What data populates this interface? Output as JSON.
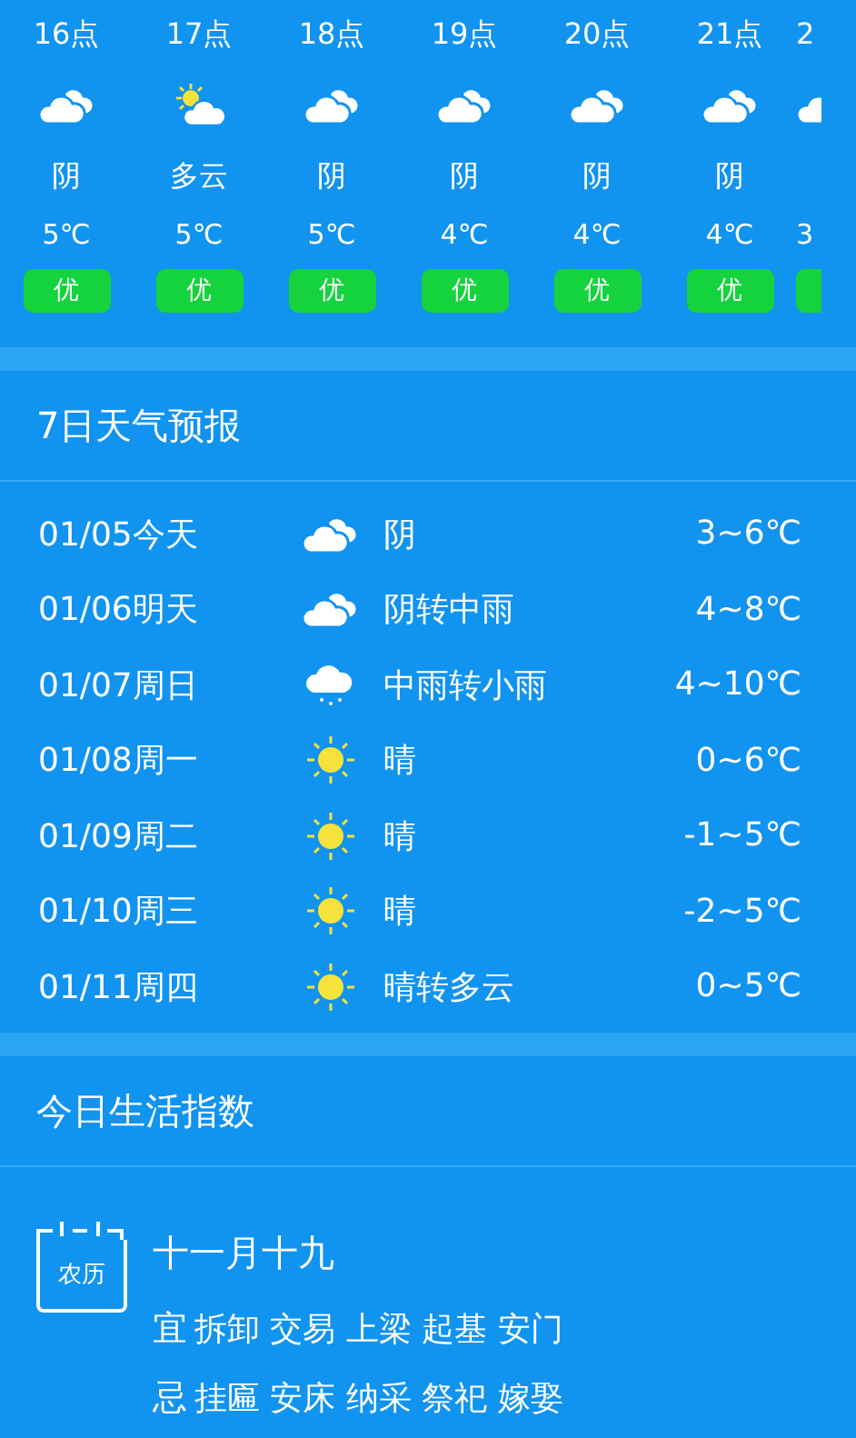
{
  "hourly": [
    {
      "hour": "16点",
      "kind": "cloudy",
      "condition": "阴",
      "temp": "5℃",
      "aqi": "优"
    },
    {
      "hour": "17点",
      "kind": "partly_cloudy",
      "condition": "多云",
      "temp": "5℃",
      "aqi": "优"
    },
    {
      "hour": "18点",
      "kind": "cloudy",
      "condition": "阴",
      "temp": "5℃",
      "aqi": "优"
    },
    {
      "hour": "19点",
      "kind": "cloudy",
      "condition": "阴",
      "temp": "4℃",
      "aqi": "优"
    },
    {
      "hour": "20点",
      "kind": "cloudy",
      "condition": "阴",
      "temp": "4℃",
      "aqi": "优"
    },
    {
      "hour": "21点",
      "kind": "cloudy",
      "condition": "阴",
      "temp": "4℃",
      "aqi": "优"
    },
    {
      "hour": "2",
      "kind": "cloudy",
      "temp": "3"
    }
  ],
  "forecast": {
    "title": "7日天气预报",
    "days": [
      {
        "date": "01/05今天",
        "kind": "cloudy",
        "condition": "阴",
        "range": "3~6℃"
      },
      {
        "date": "01/06明天",
        "kind": "cloudy",
        "condition": "阴转中雨",
        "range": "4~8℃"
      },
      {
        "date": "01/07周日",
        "kind": "rain",
        "condition": "中雨转小雨",
        "range": "4~10℃"
      },
      {
        "date": "01/08周一",
        "kind": "sunny",
        "condition": "晴",
        "range": "0~6℃"
      },
      {
        "date": "01/09周二",
        "kind": "sunny",
        "condition": "晴",
        "range": "-1~5℃"
      },
      {
        "date": "01/10周三",
        "kind": "sunny",
        "condition": "晴",
        "range": "-2~5℃"
      },
      {
        "date": "01/11周四",
        "kind": "sunny",
        "condition": "晴转多云",
        "range": "0~5℃"
      }
    ]
  },
  "life": {
    "title": "今日生活指数",
    "calendar_label": "农历",
    "lunar_date": "十一月十九",
    "good": {
      "mark": "宜",
      "items": "拆卸 交易 上梁 起基 安门"
    },
    "bad": {
      "mark": "忌",
      "items": "挂匾 安床 纳采 祭祀 嫁娶"
    }
  }
}
